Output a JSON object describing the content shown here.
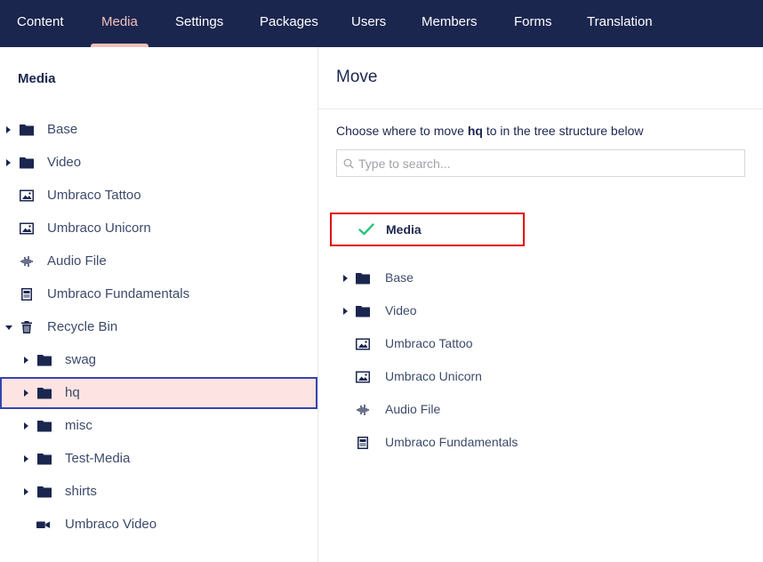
{
  "topnav": {
    "tabs": [
      {
        "label": "Content"
      },
      {
        "label": "Media",
        "active": true
      },
      {
        "label": "Settings"
      },
      {
        "label": "Packages"
      },
      {
        "label": "Users"
      },
      {
        "label": "Members"
      },
      {
        "label": "Forms"
      },
      {
        "label": "Translation"
      }
    ]
  },
  "tree": {
    "title": "Media",
    "items": [
      {
        "label": "Base",
        "icon": "folder-icon",
        "expandable": true
      },
      {
        "label": "Video",
        "icon": "folder-icon",
        "expandable": true
      },
      {
        "label": "Umbraco Tattoo",
        "icon": "image-icon"
      },
      {
        "label": "Umbraco Unicorn",
        "icon": "image-icon"
      },
      {
        "label": "Audio File",
        "icon": "audio-waveform-icon"
      },
      {
        "label": "Umbraco Fundamentals",
        "icon": "document-icon"
      },
      {
        "label": "Recycle Bin",
        "icon": "trash-icon",
        "expanded": true
      },
      {
        "label": "swag",
        "icon": "folder-icon",
        "expandable": true
      },
      {
        "label": "hq",
        "icon": "folder-icon",
        "expandable": true,
        "selected": true
      },
      {
        "label": "misc",
        "icon": "folder-icon",
        "expandable": true
      },
      {
        "label": "Test-Media",
        "icon": "folder-icon",
        "expandable": true
      },
      {
        "label": "shirts",
        "icon": "folder-icon",
        "expandable": true
      },
      {
        "label": "Umbraco Video",
        "icon": "video-camera-icon"
      }
    ]
  },
  "panel": {
    "title": "Move",
    "instruction_prefix": "Choose where to move",
    "instruction_item": "hq",
    "instruction_suffix": "to in the tree structure below",
    "search_placeholder": "Type to search...",
    "search_value": "",
    "root_label": "Media",
    "items": [
      {
        "label": "Base",
        "icon": "folder-icon",
        "expandable": true
      },
      {
        "label": "Video",
        "icon": "folder-icon",
        "expandable": true
      },
      {
        "label": "Umbraco Tattoo",
        "icon": "image-icon"
      },
      {
        "label": "Umbraco Unicorn",
        "icon": "image-icon"
      },
      {
        "label": "Audio File",
        "icon": "audio-waveform-icon"
      },
      {
        "label": "Umbraco Fundamentals",
        "icon": "document-icon"
      }
    ]
  },
  "colors": {
    "nav_bg": "#1b264f",
    "nav_active": "#f5c1bc",
    "selected_bg": "#fde3e1",
    "selected_border": "#3544b1",
    "highlight_border": "#e00000",
    "check": "#2bc37c"
  }
}
